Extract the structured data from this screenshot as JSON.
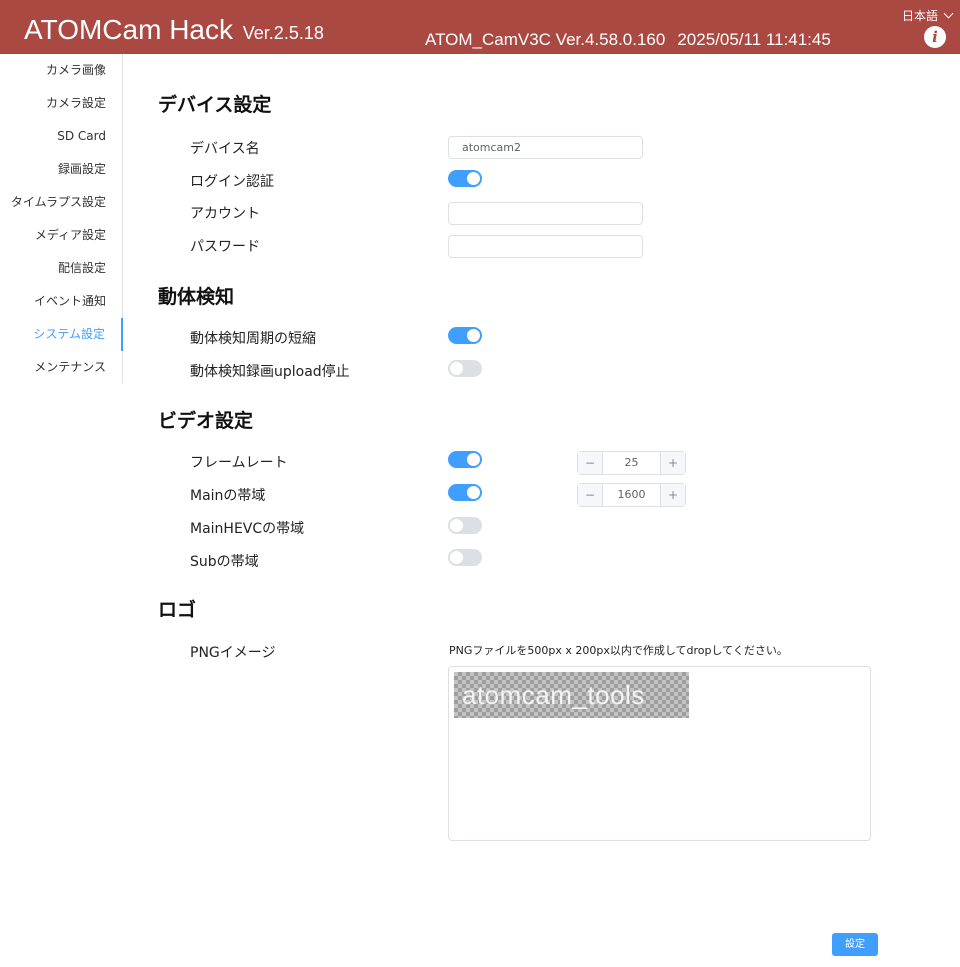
{
  "header": {
    "title": "ATOMCam Hack",
    "version": "Ver.2.5.18",
    "firmware": "ATOM_CamV3C Ver.4.58.0.160",
    "datetime": "2025/05/11 11:41:45",
    "language": "日本語",
    "info_icon": "i"
  },
  "sidebar": {
    "items": [
      {
        "label": "カメラ画像"
      },
      {
        "label": "カメラ設定"
      },
      {
        "label": "SD Card"
      },
      {
        "label": "録画設定"
      },
      {
        "label": "タイムラプス設定"
      },
      {
        "label": "メディア設定"
      },
      {
        "label": "配信設定"
      },
      {
        "label": "イベント通知"
      },
      {
        "label": "システム設定",
        "active": true
      },
      {
        "label": "メンテナンス"
      }
    ]
  },
  "device": {
    "heading": "デバイス設定",
    "name_label": "デバイス名",
    "name_value": "atomcam2",
    "login_auth_label": "ログイン認証",
    "login_auth_on": true,
    "account_label": "アカウント",
    "account_value": "",
    "password_label": "パスワード",
    "password_value": ""
  },
  "motion": {
    "heading": "動体検知",
    "short_period_label": "動体検知周期の短縮",
    "short_period_on": true,
    "stop_upload_label": "動体検知録画upload停止",
    "stop_upload_on": false
  },
  "video": {
    "heading": "ビデオ設定",
    "framerate_label": "フレームレート",
    "framerate_on": true,
    "framerate_value": "25",
    "main_bw_label": "Mainの帯域",
    "main_bw_on": true,
    "main_bw_value": "1600",
    "main_hevc_label": "MainHEVCの帯域",
    "main_hevc_on": false,
    "sub_label": "Subの帯域",
    "sub_on": false,
    "minus": "−",
    "plus": "+"
  },
  "logo": {
    "heading": "ロゴ",
    "png_label": "PNGイメージ",
    "hint": "PNGファイルを500px x 200px以内で作成してdropしてください。",
    "preview_text": "atomcam_tools"
  },
  "footer": {
    "submit_label": "設定"
  },
  "colors": {
    "header_bg": "#aa4842",
    "accent": "#409eff",
    "switch_off": "#dcdfe6"
  }
}
